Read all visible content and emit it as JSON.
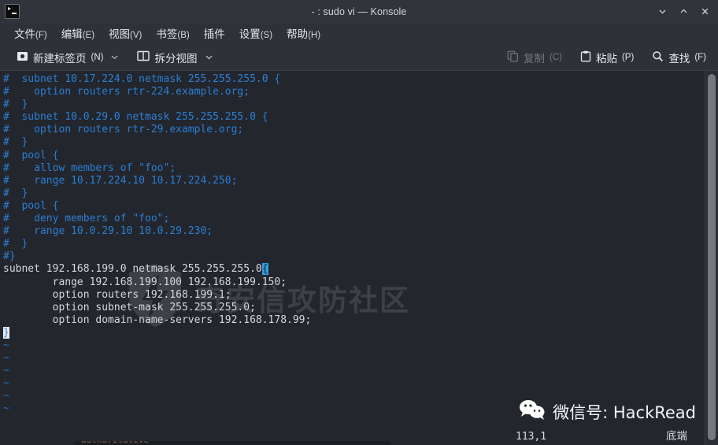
{
  "window": {
    "title": "- : sudo vi — Konsole",
    "app_icon": "terminal-icon",
    "controls": [
      {
        "name": "minimize-button",
        "glyph": "chevron-down-icon"
      },
      {
        "name": "maximize-button",
        "glyph": "chevron-up-icon"
      },
      {
        "name": "close-button",
        "glyph": "close-icon"
      }
    ]
  },
  "menubar": {
    "items": [
      {
        "label": "文件",
        "mnemonic": "(F)"
      },
      {
        "label": "编辑",
        "mnemonic": "(E)"
      },
      {
        "label": "视图",
        "mnemonic": "(V)"
      },
      {
        "label": "书签",
        "mnemonic": "(B)"
      },
      {
        "label": "插件",
        "mnemonic": ""
      },
      {
        "label": "设置",
        "mnemonic": "(S)"
      },
      {
        "label": "帮助",
        "mnemonic": "(H)"
      }
    ]
  },
  "toolbar": {
    "new_tab": {
      "label": "新建标签页",
      "mnemonic": "(N)",
      "icon": "new-tab-icon",
      "has_dropdown": true
    },
    "split_view": {
      "label": "拆分视图",
      "mnemonic": "",
      "icon": "split-view-icon",
      "has_dropdown": true
    },
    "copy": {
      "label": "复制",
      "mnemonic": "(C)",
      "icon": "copy-icon",
      "disabled": true
    },
    "paste": {
      "label": "粘贴",
      "mnemonic": "(P)",
      "icon": "paste-icon",
      "disabled": false
    },
    "find": {
      "label": "查找",
      "mnemonic": "(F)",
      "icon": "search-icon",
      "disabled": false
    }
  },
  "terminal": {
    "lines": [
      "#  subnet 10.17.224.0 netmask 255.255.255.0 {",
      "#    option routers rtr-224.example.org;",
      "#  }",
      "#  subnet 10.0.29.0 netmask 255.255.255.0 {",
      "#    option routers rtr-29.example.org;",
      "#  }",
      "#  pool {",
      "#    allow members of \"foo\";",
      "#    range 10.17.224.10 10.17.224.250;",
      "#  }",
      "#  pool {",
      "#    deny members of \"foo\";",
      "#    range 10.0.29.10 10.0.29.230;",
      "#  }",
      "#}"
    ],
    "active_lines": [
      "subnet 192.168.199.0 netmask 255.255.255.0",
      "        range 192.168.199.100 192.168.199.150;",
      "        option routers 192.168.199.1;",
      "        option subnet-mask 255.255.255.0;",
      "        option domain-name-servers 192.168.178.99;"
    ],
    "cursor_char": "{",
    "closing_brace": "}",
    "tilde_rows": 6,
    "tilde_char": "~",
    "colors": {
      "background": "#23262d",
      "comment": "#2b7fd4",
      "foreground": "#d9dce0",
      "cursor": "#2f9fe0",
      "brace_highlight": "#e9ecef"
    }
  },
  "vi_status": {
    "position": "113,1",
    "mode": "底端"
  },
  "watermarks": {
    "center": {
      "text": "奇安信攻防社区",
      "icon": "shield-bolt-icon"
    },
    "wechat": {
      "text": "微信号: HackRead",
      "icon": "wechat-icon"
    }
  },
  "bottom_peek": {
    "text": "authoritative"
  }
}
